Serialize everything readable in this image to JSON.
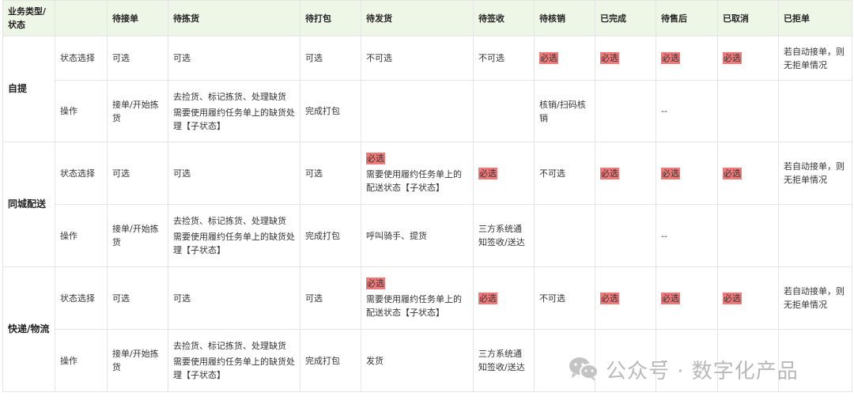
{
  "headers": [
    "业务类型/状态",
    "",
    "待接单",
    "待拣货",
    "待打包",
    "待发货",
    "待签收",
    "待核销",
    "已完成",
    "待售后",
    "已取消",
    "已拒单"
  ],
  "groups": [
    {
      "name": "自提",
      "status_row": {
        "label": "状态选择",
        "cells": [
          "可选",
          "可选",
          "可选",
          "不可选",
          "不可选",
          "必选",
          "必选",
          "必选",
          "必选",
          "若自动接单，则无拒单情况"
        ]
      },
      "op_row": {
        "label": "操作",
        "accept": "接单/开始拣货",
        "pick": [
          "去捡货、标记拣货、处理缺货",
          "需要使用履约任务单上的缺货处理【子状态】"
        ],
        "pack": "完成打包",
        "verify": "核销/扫码核销",
        "dash": "--"
      }
    },
    {
      "name": "同城配送",
      "status_row": {
        "label": "状态选择",
        "cells": [
          "可选",
          "可选",
          "可选",
          "必选",
          "需要使用履约任务单上的配送状态【子状态】",
          "必选",
          "不可选",
          "必选",
          "必选",
          "必选",
          "若自动接单，则无拒单情况"
        ]
      },
      "op_row": {
        "label": "操作",
        "accept": "接单/开始拣货",
        "pick": [
          "去捡货、标记拣货、处理缺货",
          "需要使用履约任务单上的缺货处理【子状态】"
        ],
        "pack": "完成打包",
        "ship": "呼叫骑手、提货",
        "sign": "三方系统通知签收/送达",
        "dash": "--"
      }
    },
    {
      "name": "快递/物流",
      "status_row": {
        "label": "状态选择",
        "cells": [
          "可选",
          "可选",
          "可选",
          "必选",
          "需要使用履约任务单上的配送状态【子状态】",
          "必选",
          "不可选",
          "必选",
          "必选",
          "必选",
          "若自动接单，则无拒单情况"
        ]
      },
      "op_row": {
        "label": "操作",
        "accept": "接单/开始拣货",
        "pick": [
          "去捡货、标记拣货、处理缺货",
          "需要使用履约任务单上的缺货处理【子状态】"
        ],
        "pack": "完成打包",
        "ship": "发货",
        "sign": "三方系统通知签收/送达",
        "dash": "--"
      }
    }
  ],
  "watermark": {
    "icon": "wechat-icon",
    "text": "公众号 · 数字化产品"
  },
  "colors": {
    "header_bg": "#eef7e7",
    "required_highlight": "#f07a7a",
    "border": "#e3e6e4"
  }
}
